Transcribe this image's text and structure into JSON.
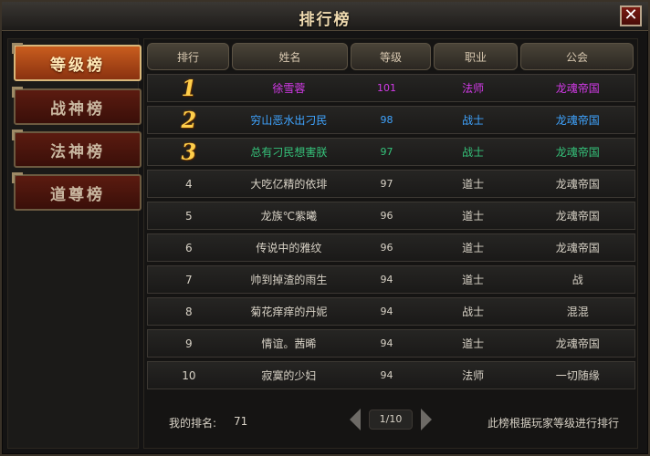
{
  "window": {
    "title": "排行榜",
    "close_label": "✕"
  },
  "sidebar": {
    "tabs": [
      {
        "label": "等级榜",
        "active": true
      },
      {
        "label": "战神榜",
        "active": false
      },
      {
        "label": "法神榜",
        "active": false
      },
      {
        "label": "道尊榜",
        "active": false
      }
    ]
  },
  "table": {
    "headers": [
      "排行",
      "姓名",
      "等级",
      "职业",
      "公会"
    ],
    "rows": [
      {
        "rank": "1",
        "name": "徐雪蓉",
        "level": "101",
        "job": "法师",
        "guild": "龙魂帝国",
        "color": "#d33ae8"
      },
      {
        "rank": "2",
        "name": "穷山恶水出刁民",
        "level": "98",
        "job": "战士",
        "guild": "龙魂帝国",
        "color": "#3fa4ff"
      },
      {
        "rank": "3",
        "name": "总有刁民想害朕",
        "level": "97",
        "job": "战士",
        "guild": "龙魂帝国",
        "color": "#35c27a"
      },
      {
        "rank": "4",
        "name": "大吃亿精的依琲",
        "level": "97",
        "job": "道士",
        "guild": "龙魂帝国",
        "color": "#d8d2c6"
      },
      {
        "rank": "5",
        "name": "龙族℃紫曦",
        "level": "96",
        "job": "道士",
        "guild": "龙魂帝国",
        "color": "#d8d2c6"
      },
      {
        "rank": "6",
        "name": "传说中的雅纹",
        "level": "96",
        "job": "道士",
        "guild": "龙魂帝国",
        "color": "#d8d2c6"
      },
      {
        "rank": "7",
        "name": "帅到掉渣的雨生",
        "level": "94",
        "job": "道士",
        "guild": "战",
        "color": "#d8d2c6"
      },
      {
        "rank": "8",
        "name": "菊花痒痒的丹妮",
        "level": "94",
        "job": "战士",
        "guild": "混混",
        "color": "#d8d2c6"
      },
      {
        "rank": "9",
        "name": "情谊。茜晞",
        "level": "94",
        "job": "道士",
        "guild": "龙魂帝国",
        "color": "#d8d2c6"
      },
      {
        "rank": "10",
        "name": "寂寞的少妇",
        "level": "94",
        "job": "法师",
        "guild": "一切随缘",
        "color": "#d8d2c6"
      }
    ]
  },
  "footer": {
    "my_rank_label": "我的排名:",
    "my_rank_value": "71",
    "page": "1/10",
    "note": "此榜根据玩家等级进行排行"
  }
}
